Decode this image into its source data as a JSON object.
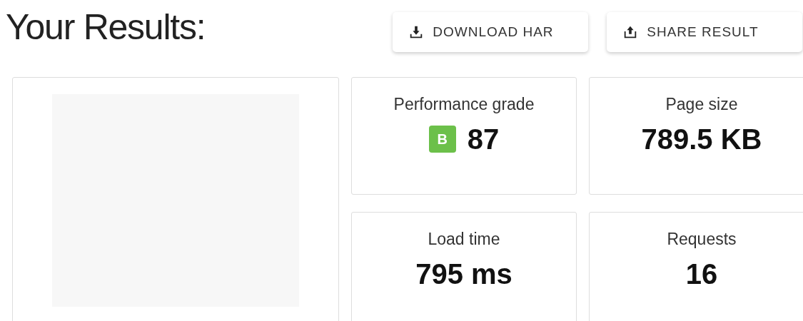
{
  "heading": "Your Results:",
  "buttons": [
    {
      "label": "DOWNLOAD HAR",
      "kind": "download"
    },
    {
      "label": "SHARE RESULT",
      "kind": "share"
    }
  ],
  "metrics": [
    {
      "label": "Performance grade",
      "value": "87",
      "grade": {
        "letter": "B",
        "color": "#6cc04a"
      }
    },
    {
      "label": "Page size",
      "value": "789.5 KB"
    },
    {
      "label": "Load time",
      "value": "795 ms"
    },
    {
      "label": "Requests",
      "value": "16"
    }
  ]
}
